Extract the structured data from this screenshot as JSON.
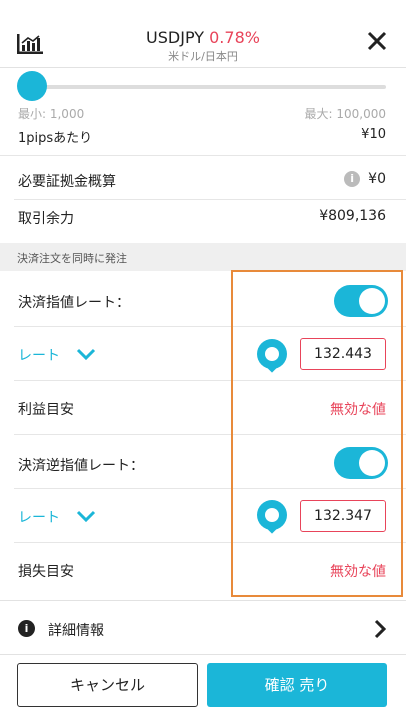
{
  "header": {
    "pair": "USDJPY",
    "change": "0.78%",
    "subtitle": "米ドル/日本円",
    "chart_icon": "chart-icon",
    "close_icon": "close-icon"
  },
  "slider": {
    "min_label": "最小: 1,000",
    "max_label": "最大: 100,000",
    "level": 0.0
  },
  "rows": {
    "per_pip_label": "1pipsあたり",
    "per_pip_value": "¥10",
    "margin_label": "必要証拠金概算",
    "margin_value": "¥0",
    "available_label": "取引余力",
    "available_value": "¥809,136"
  },
  "section_title": "決済注文を同時に発注",
  "limit": {
    "label": "決済指値レート：",
    "toggle_on": true,
    "rate_select": "レート",
    "rate_value": "132.443",
    "profit_label": "利益目安",
    "profit_value": "無効な値"
  },
  "stop": {
    "label": "決済逆指値レート：",
    "toggle_on": true,
    "rate_select": "レート",
    "rate_value": "132.347",
    "loss_label": "損失目安",
    "loss_value": "無効な値"
  },
  "details_label": "詳細情報",
  "buttons": {
    "cancel": "キャンセル",
    "confirm": "確認 売り"
  },
  "colors": {
    "accent": "#1bb6d8",
    "negative": "#e8445a",
    "highlight": "#e88a3a"
  }
}
